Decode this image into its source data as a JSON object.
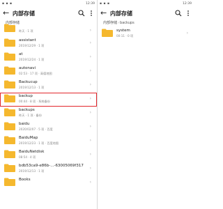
{
  "status": {
    "time": "12:39",
    "icons": "▪ ▪ ▪"
  },
  "left": {
    "title": "内部存储",
    "breadcrumb": "内部存储",
    "folders": [
      {
        "name": "",
        "meta": "昨天 · 1 项"
      },
      {
        "name": "assistant",
        "meta": "2019/12/29 · 1 项"
      },
      {
        "name": "at",
        "meta": "2019/12/24 · 1 项"
      },
      {
        "name": "autonavi",
        "meta": "02:53 · 17 项 · 高德地图"
      },
      {
        "name": "Backucup",
        "meta": "2019/12/13 · 1 项"
      },
      {
        "name": "backup",
        "meta": "00:44 · 8 项 · 系统备份"
      },
      {
        "name": "backups",
        "meta": "昨天 · 1 项 · 备份"
      },
      {
        "name": "baidu",
        "meta": "2020/02/07 · 5 项 · 百度"
      },
      {
        "name": "BaiduMap",
        "meta": "2019/12/23 · 1 项 · 百度地图"
      },
      {
        "name": "BaiduNetdisk",
        "meta": "08:54 · 4 项"
      },
      {
        "name": "bdb53ca9-e86b-...-63005069f317",
        "meta": "2019/12/13 · 1 项"
      },
      {
        "name": "Books",
        "meta": ""
      }
    ]
  },
  "right": {
    "title": "内部存储",
    "breadcrumb_root": "内部存储",
    "breadcrumb_current": "backups",
    "breadcrumb_sep": "›",
    "folders": [
      {
        "name": "system",
        "meta": "00:11 · 0 项"
      }
    ]
  },
  "icons": {
    "back": "back-arrow-icon",
    "search": "search-icon",
    "menu": "more-vert-icon",
    "folder": "folder-icon",
    "chevron": "chevron-right-icon"
  },
  "colors": {
    "folder": "#f5b82e",
    "highlight": "#e2262c"
  },
  "highlighted_index": 5
}
